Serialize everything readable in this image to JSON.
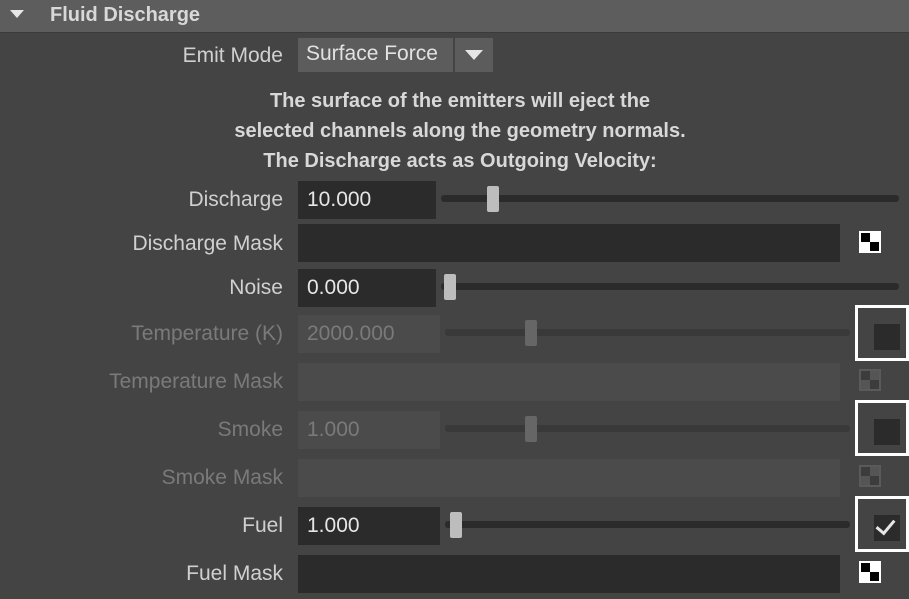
{
  "section": {
    "title": "Fluid Discharge"
  },
  "emit_mode": {
    "label": "Emit Mode",
    "value": "Surface Force"
  },
  "description": [
    "The surface of the emitters will eject the",
    "selected channels along the geometry normals.",
    "The Discharge acts as Outgoing Velocity:"
  ],
  "discharge": {
    "label": "Discharge",
    "value": "10.000"
  },
  "discharge_mask": {
    "label": "Discharge Mask"
  },
  "noise": {
    "label": "Noise",
    "value": "0.000"
  },
  "temperature": {
    "label": "Temperature (K)",
    "value": "2000.000",
    "enabled": false
  },
  "temperature_mask": {
    "label": "Temperature Mask"
  },
  "smoke": {
    "label": "Smoke",
    "value": "1.000",
    "enabled": false
  },
  "smoke_mask": {
    "label": "Smoke Mask"
  },
  "fuel": {
    "label": "Fuel",
    "value": "1.000",
    "enabled": true
  },
  "fuel_mask": {
    "label": "Fuel Mask"
  },
  "colors": {
    "panel_bg": "#444444",
    "header_bg": "#5d5d5d",
    "field_bg": "#2b2b2b",
    "disabled_text": "#7a7a7a",
    "highlight_border": "#ffffff"
  }
}
